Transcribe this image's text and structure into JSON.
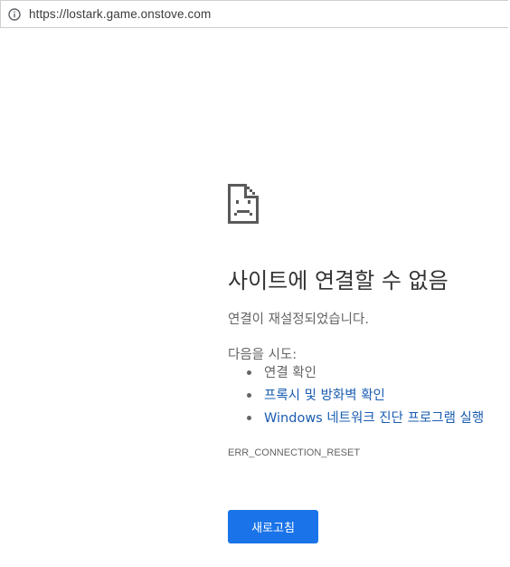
{
  "browser": {
    "url": "https://lostark.game.onstove.com",
    "url_icon": "info-icon"
  },
  "error": {
    "icon": "sad-document-icon",
    "title": "사이트에 연결할 수 없음",
    "description": "연결이 재설정되었습니다.",
    "suggestions_heading": "다음을 시도:",
    "suggestions": [
      {
        "label": "연결 확인",
        "is_link": false
      },
      {
        "label": "프록시 및 방화벽 확인",
        "is_link": true
      },
      {
        "label": "Windows 네트워크 진단 프로그램 실행",
        "is_link": true
      }
    ],
    "code": "ERR_CONNECTION_RESET",
    "reload_label": "새로고침"
  },
  "colors": {
    "link": "#1a5cb0",
    "button": "#1a73e8",
    "text": "#646464",
    "title": "#333333"
  }
}
